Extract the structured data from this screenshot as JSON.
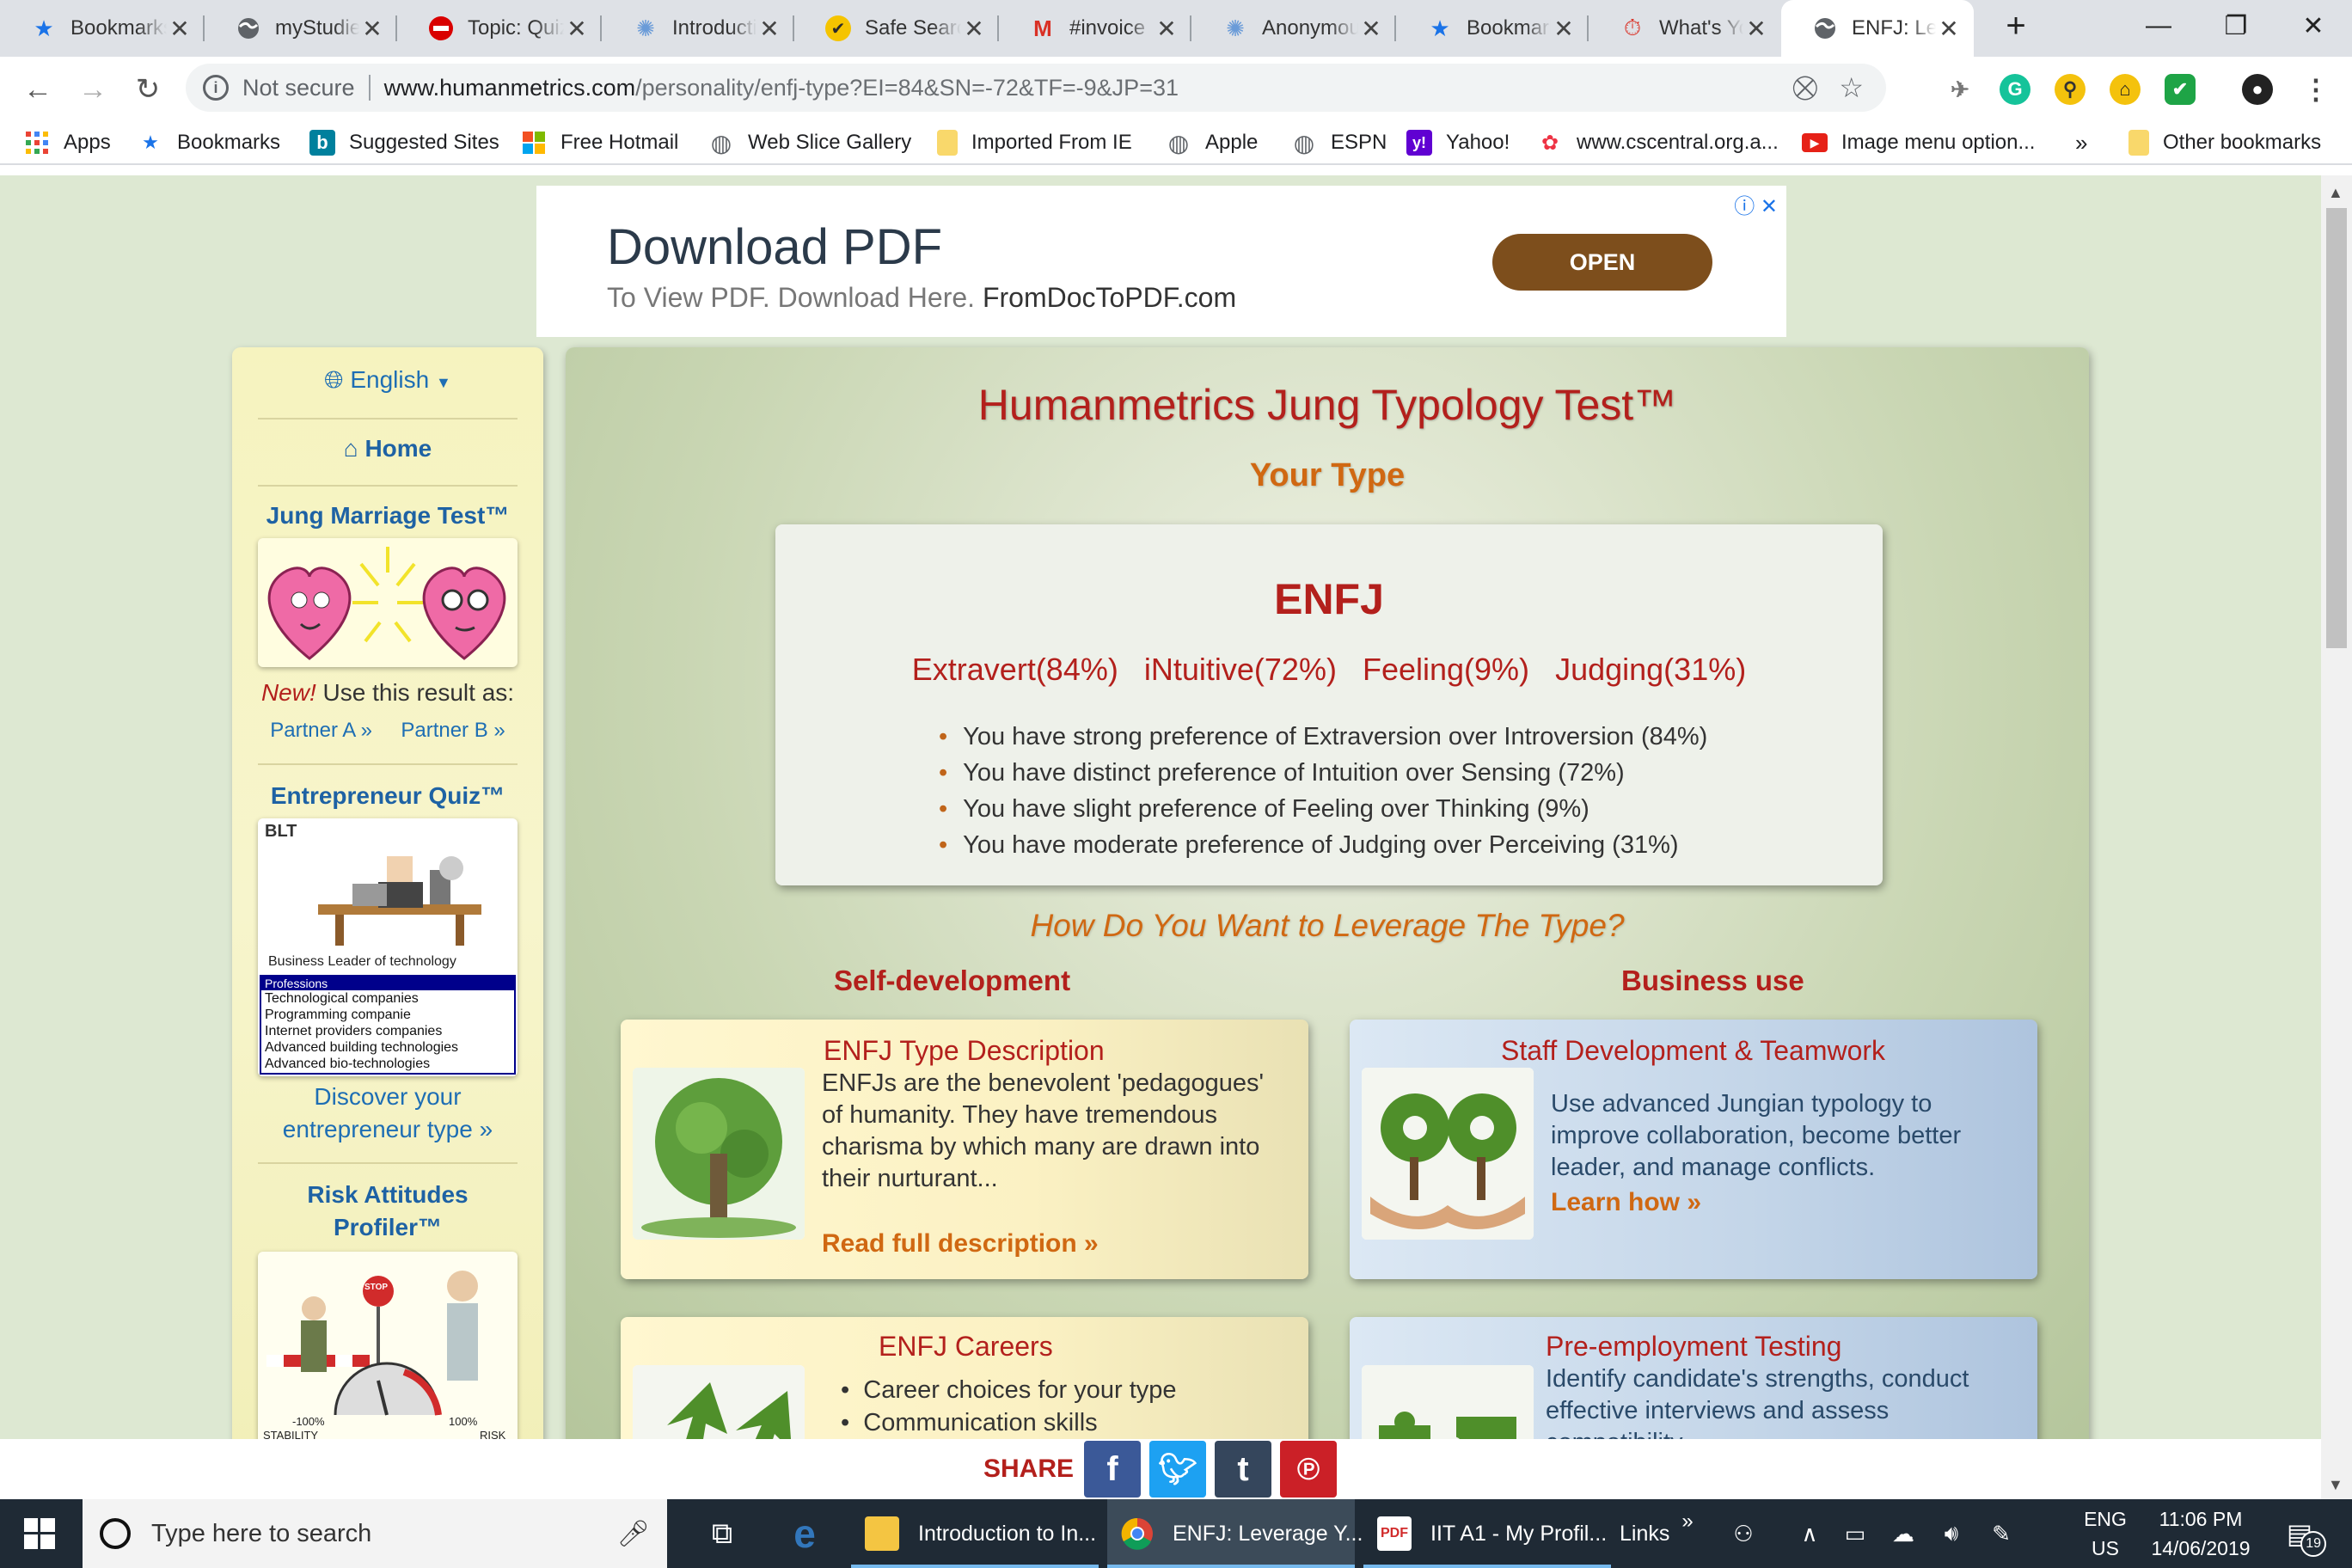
{
  "browser": {
    "tabs": [
      {
        "title": "Bookmarks",
        "icon": "star-icon"
      },
      {
        "title": "myStudies",
        "icon": "globe-icon"
      },
      {
        "title": "Topic: Quiz",
        "icon": "red-cross-icon"
      },
      {
        "title": "Introduction",
        "icon": "dots-icon"
      },
      {
        "title": "Safe Search",
        "icon": "check-icon"
      },
      {
        "title": "#invoice",
        "icon": "gmail-icon"
      },
      {
        "title": "Anonymous",
        "icon": "dots-icon"
      },
      {
        "title": "Bookmarks",
        "icon": "star-icon"
      },
      {
        "title": "What's Your",
        "icon": "stopwatch-icon"
      },
      {
        "title": "ENFJ: Leverage",
        "icon": "globe-icon",
        "active": true
      }
    ],
    "new_tab": "+",
    "window_controls": {
      "minimize": "—",
      "restore": "❐",
      "close": "✕"
    },
    "address": {
      "security": "Not secure",
      "host": "www.humanmetrics.com",
      "path": "/personality/enfj-type?EI=84&SN=-72&TF=-9&JP=31"
    },
    "bookmarks": [
      {
        "label": "Apps",
        "icon": "apps-grid-icon"
      },
      {
        "label": "Bookmarks",
        "icon": "star-icon"
      },
      {
        "label": "Suggested Sites",
        "icon": "bing-icon"
      },
      {
        "label": "Free Hotmail",
        "icon": "windows-icon"
      },
      {
        "label": "Web Slice Gallery",
        "icon": "globe-icon"
      },
      {
        "label": "Imported From IE",
        "icon": "folder-icon"
      },
      {
        "label": "Apple",
        "icon": "globe-icon"
      },
      {
        "label": "ESPN",
        "icon": "globe-icon"
      },
      {
        "label": "Yahoo!",
        "icon": "yahoo-icon"
      },
      {
        "label": "www.cscentral.org.a...",
        "icon": "colorful-icon"
      },
      {
        "label": "Image menu option...",
        "icon": "youtube-icon"
      }
    ],
    "bookmarks_more": "»",
    "other_bookmarks": "Other bookmarks"
  },
  "ad": {
    "headline": "Download PDF",
    "subline": "To View PDF. Download Here.",
    "domain": "FromDocToPDF.com",
    "button": "OPEN",
    "adchoices": "ⓘ ✕"
  },
  "sidebar": {
    "language": "English",
    "home": "Home",
    "marriage_title": "Jung Marriage Test™",
    "new_label": "New!",
    "use_result": "Use this result as:",
    "partner_a": "Partner A »",
    "partner_b": "Partner B »",
    "entrepreneur_title": "Entrepreneur Quiz™",
    "blt_label": "BLT",
    "blt_caption": "Business Leader of technology",
    "professions_header": "Professions",
    "professions": [
      "Technological companies",
      "Programming companie",
      "Internet providers companies",
      "Advanced building technologies",
      "Advanced bio-technologies"
    ],
    "discover_1": "Discover your",
    "discover_2": "entrepreneur type »",
    "risk_title_1": "Risk Attitudes",
    "risk_title_2": "Profiler™",
    "risk_stop": "STOP",
    "risk_left": "-100%",
    "risk_right": "100%",
    "risk_stability": "STABILITY",
    "risk_risk": "RISK"
  },
  "main": {
    "title": "Humanmetrics Jung Typology Test™",
    "subtitle": "Your Type",
    "type_code": "ENFJ",
    "scores": [
      "Extravert(84%)",
      "iNtuitive(72%)",
      "Feeling(9%)",
      "Judging(31%)"
    ],
    "preferences": [
      "You have strong preference of Extraversion over Introversion (84%)",
      "You have distinct preference of Intuition over Sensing (72%)",
      "You have slight preference of Feeling over Thinking (9%)",
      "You have moderate preference of Judging over Perceiving (31%)"
    ],
    "leverage_question": "How Do You Want to Leverage The Type?",
    "self_dev": "Self-development",
    "business_use": "Business use",
    "cards": {
      "description": {
        "title": "ENFJ Type Description",
        "lines": [
          "ENFJs are the benevolent 'pedagogues'",
          "of humanity. They have tremendous",
          "charisma by which many are drawn into",
          "their nurturant..."
        ],
        "link": "Read full description »"
      },
      "staff": {
        "title": "Staff Development & Teamwork",
        "lines": [
          "Use advanced Jungian typology to",
          "improve collaboration, become better",
          "leader, and manage conflicts."
        ],
        "link": "Learn how »"
      },
      "careers": {
        "title": "ENFJ Careers",
        "items": [
          "Career choices for your type",
          "Communication skills"
        ]
      },
      "preemployment": {
        "title": "Pre-employment Testing",
        "lines": [
          "Identify candidate's strengths, conduct",
          "effective interviews and assess",
          "compatibility"
        ]
      }
    },
    "share_label": "SHARE",
    "share_buttons": [
      "f",
      "t",
      "t",
      "p"
    ]
  },
  "taskbar": {
    "search_placeholder": "Type here to search",
    "apps": [
      {
        "label": "Introduction to In...",
        "icon": "folder-icon"
      },
      {
        "label": "ENFJ: Leverage Y...",
        "icon": "chrome-icon"
      },
      {
        "label": "IIT A1 - My Profil...",
        "icon": "pdf-icon"
      }
    ],
    "links": "Links",
    "links_more": "»",
    "lang_1": "ENG",
    "lang_2": "US",
    "time": "11:06 PM",
    "date": "14/06/2019",
    "notifications": "19"
  },
  "colors": {
    "brand_red": "#b3201c",
    "link_orange": "#d06812",
    "sidebar_blue": "#1e6eb4",
    "page_bg": "#dde8d2"
  }
}
